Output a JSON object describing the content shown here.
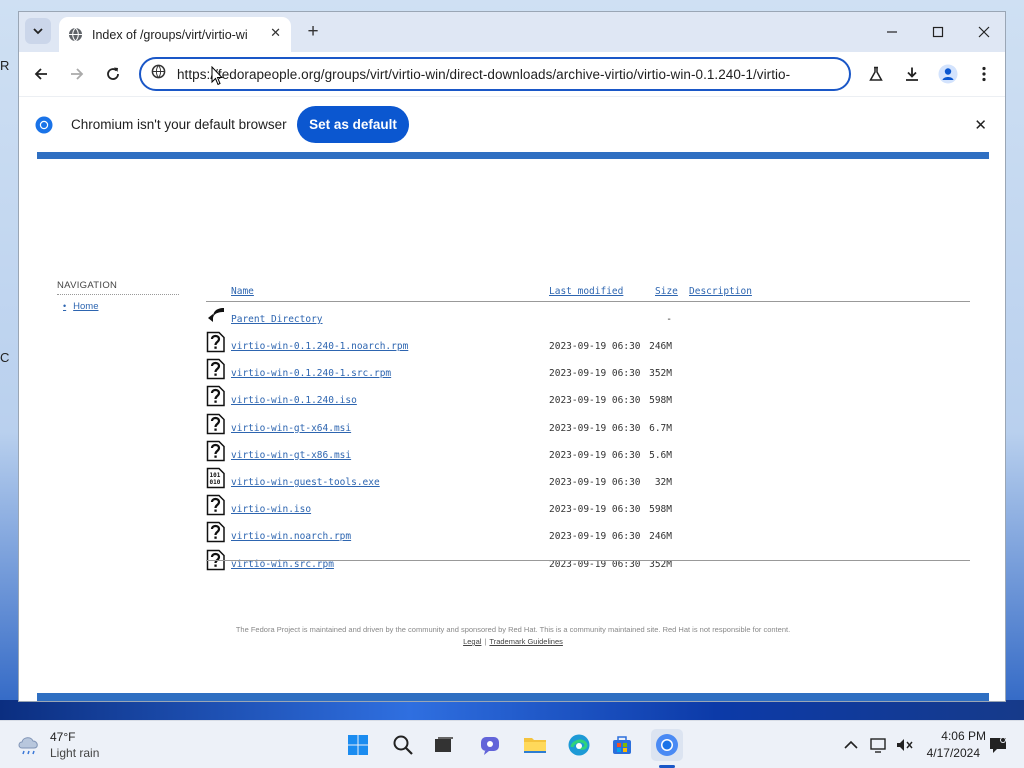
{
  "browser": {
    "tab_title": "Index of /groups/virt/virtio-wi",
    "url": "https://fedorapeople.org/groups/virt/virtio-win/direct-downloads/archive-virtio/virtio-win-0.1.240-1/virtio-",
    "infobar_text": "Chromium isn't your default browser",
    "infobar_button": "Set as default"
  },
  "sidebar": {
    "heading": "NAVIGATION",
    "home_link": "Home"
  },
  "listing": {
    "headers": {
      "name": "Name",
      "modified": "Last modified",
      "size": "Size",
      "description": "Description"
    },
    "parent": {
      "name": "Parent Directory",
      "size": "-"
    },
    "rows": [
      {
        "name": "virtio-win-0.1.240-1.noarch.rpm",
        "modified": "2023-09-19 06:30",
        "size": "246M",
        "icon": "unknown-file-icon"
      },
      {
        "name": "virtio-win-0.1.240-1.src.rpm",
        "modified": "2023-09-19 06:30",
        "size": "352M",
        "icon": "unknown-file-icon"
      },
      {
        "name": "virtio-win-0.1.240.iso",
        "modified": "2023-09-19 06:30",
        "size": "598M",
        "icon": "unknown-file-icon"
      },
      {
        "name": "virtio-win-gt-x64.msi",
        "modified": "2023-09-19 06:30",
        "size": "6.7M",
        "icon": "unknown-file-icon"
      },
      {
        "name": "virtio-win-gt-x86.msi",
        "modified": "2023-09-19 06:30",
        "size": "5.6M",
        "icon": "unknown-file-icon"
      },
      {
        "name": "virtio-win-guest-tools.exe",
        "modified": "2023-09-19 06:30",
        "size": "32M",
        "icon": "binary-file-icon"
      },
      {
        "name": "virtio-win.iso",
        "modified": "2023-09-19 06:30",
        "size": "598M",
        "icon": "unknown-file-icon"
      },
      {
        "name": "virtio-win.noarch.rpm",
        "modified": "2023-09-19 06:30",
        "size": "246M",
        "icon": "unknown-file-icon"
      },
      {
        "name": "virtio-win.src.rpm",
        "modified": "2023-09-19 06:30",
        "size": "352M",
        "icon": "unknown-file-icon"
      }
    ]
  },
  "footer": {
    "text": "The Fedora Project is maintained and driven by the community and sponsored by Red Hat. This is a community maintained site. Red Hat is not responsible for content.",
    "legal": "Legal",
    "trademark": "Trademark Guidelines"
  },
  "taskbar": {
    "weather_temp": "47°F",
    "weather_desc": "Light rain",
    "time": "4:06 PM",
    "date": "4/17/2024"
  },
  "colors": {
    "accent": "#0b57d0",
    "page_bar": "#2f6fc2",
    "link": "#2d65b0"
  }
}
